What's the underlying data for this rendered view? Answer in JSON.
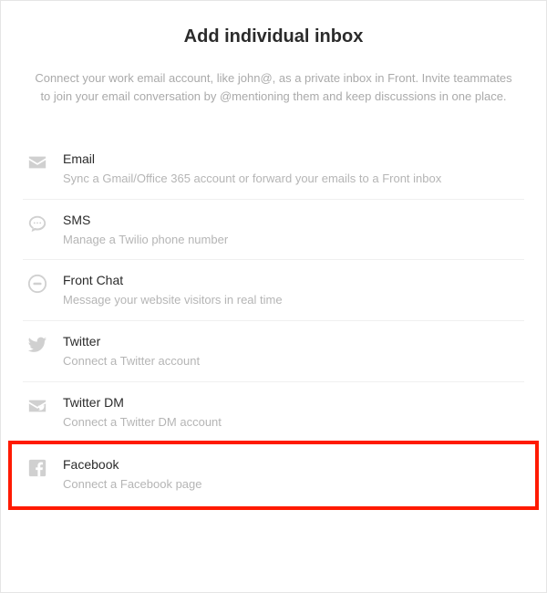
{
  "header": {
    "title": "Add individual inbox",
    "description": "Connect your work email account, like john@, as a private inbox in Front. Invite teammates to join your email conversation by @mentioning them and keep discussions in one place."
  },
  "channels": [
    {
      "icon": "email-icon",
      "label": "Email",
      "sub": "Sync a Gmail/Office 365 account or forward your emails to a Front inbox",
      "highlight": false
    },
    {
      "icon": "sms-icon",
      "label": "SMS",
      "sub": "Manage a Twilio phone number",
      "highlight": false
    },
    {
      "icon": "front-chat-icon",
      "label": "Front Chat",
      "sub": "Message your website visitors in real time",
      "highlight": false
    },
    {
      "icon": "twitter-icon",
      "label": "Twitter",
      "sub": "Connect a Twitter account",
      "highlight": false
    },
    {
      "icon": "twitter-dm-icon",
      "label": "Twitter DM",
      "sub": "Connect a Twitter DM account",
      "highlight": false
    },
    {
      "icon": "facebook-icon",
      "label": "Facebook",
      "sub": "Connect a Facebook page",
      "highlight": true
    }
  ]
}
